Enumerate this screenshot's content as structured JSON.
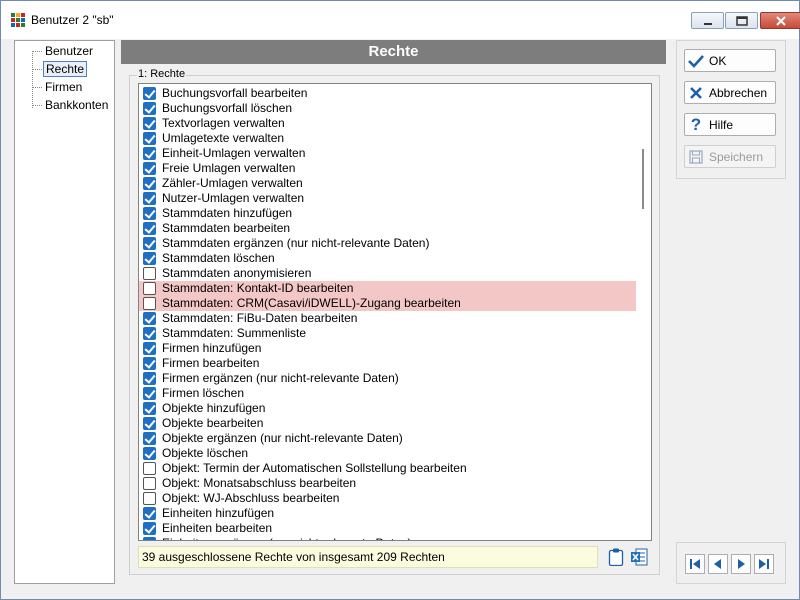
{
  "window": {
    "title": "Benutzer 2 \"sb\""
  },
  "nav": {
    "items": [
      {
        "label": "Benutzer",
        "selected": false
      },
      {
        "label": "Rechte",
        "selected": true
      },
      {
        "label": "Firmen",
        "selected": false
      },
      {
        "label": "Bankkonten",
        "selected": false
      }
    ]
  },
  "main": {
    "header": "Rechte",
    "group_label": "1: Rechte",
    "status": "39 ausgeschlossene Rechte von insgesamt 209 Rechten"
  },
  "rights": [
    {
      "label": "Buchungsvorfall bearbeiten",
      "checked": true,
      "highlight": false
    },
    {
      "label": "Buchungsvorfall löschen",
      "checked": true,
      "highlight": false
    },
    {
      "label": "Textvorlagen verwalten",
      "checked": true,
      "highlight": false
    },
    {
      "label": "Umlagetexte verwalten",
      "checked": true,
      "highlight": false
    },
    {
      "label": "Einheit-Umlagen verwalten",
      "checked": true,
      "highlight": false
    },
    {
      "label": "Freie Umlagen verwalten",
      "checked": true,
      "highlight": false
    },
    {
      "label": "Zähler-Umlagen verwalten",
      "checked": true,
      "highlight": false
    },
    {
      "label": "Nutzer-Umlagen verwalten",
      "checked": true,
      "highlight": false
    },
    {
      "label": "Stammdaten hinzufügen",
      "checked": true,
      "highlight": false
    },
    {
      "label": "Stammdaten bearbeiten",
      "checked": true,
      "highlight": false
    },
    {
      "label": "Stammdaten ergänzen (nur nicht-relevante Daten)",
      "checked": true,
      "highlight": false
    },
    {
      "label": "Stammdaten löschen",
      "checked": true,
      "highlight": false
    },
    {
      "label": "Stammdaten anonymisieren",
      "checked": false,
      "highlight": false
    },
    {
      "label": "Stammdaten: Kontakt-ID bearbeiten",
      "checked": false,
      "highlight": true
    },
    {
      "label": "Stammdaten: CRM(Casavi/iDWELL)-Zugang bearbeiten",
      "checked": false,
      "highlight": true
    },
    {
      "label": "Stammdaten: FiBu-Daten bearbeiten",
      "checked": true,
      "highlight": false
    },
    {
      "label": "Stammdaten: Summenliste",
      "checked": true,
      "highlight": false
    },
    {
      "label": "Firmen hinzufügen",
      "checked": true,
      "highlight": false
    },
    {
      "label": "Firmen bearbeiten",
      "checked": true,
      "highlight": false
    },
    {
      "label": "Firmen ergänzen (nur nicht-relevante Daten)",
      "checked": true,
      "highlight": false
    },
    {
      "label": "Firmen löschen",
      "checked": true,
      "highlight": false
    },
    {
      "label": "Objekte hinzufügen",
      "checked": true,
      "highlight": false
    },
    {
      "label": "Objekte bearbeiten",
      "checked": true,
      "highlight": false
    },
    {
      "label": "Objekte ergänzen (nur nicht-relevante Daten)",
      "checked": true,
      "highlight": false
    },
    {
      "label": "Objekte löschen",
      "checked": true,
      "highlight": false
    },
    {
      "label": "Objekt: Termin der Automatischen Sollstellung bearbeiten",
      "checked": false,
      "highlight": false
    },
    {
      "label": "Objekt: Monatsabschluss bearbeiten",
      "checked": false,
      "highlight": false
    },
    {
      "label": "Objekt: WJ-Abschluss bearbeiten",
      "checked": false,
      "highlight": false
    },
    {
      "label": "Einheiten hinzufügen",
      "checked": true,
      "highlight": false
    },
    {
      "label": "Einheiten bearbeiten",
      "checked": true,
      "highlight": false
    },
    {
      "label": "Einheiten ergänzen (nur nicht-relevante Daten)",
      "checked": true,
      "highlight": false
    }
  ],
  "buttons": {
    "ok": "OK",
    "cancel": "Abbrechen",
    "help": "Hilfe",
    "save": "Speichern"
  },
  "colors": {
    "checkbox_checked": "#1f6fc5",
    "highlight_row": "#f4c7c7",
    "header_band": "#7d7d7d",
    "status_bg": "#fbfbdf"
  }
}
